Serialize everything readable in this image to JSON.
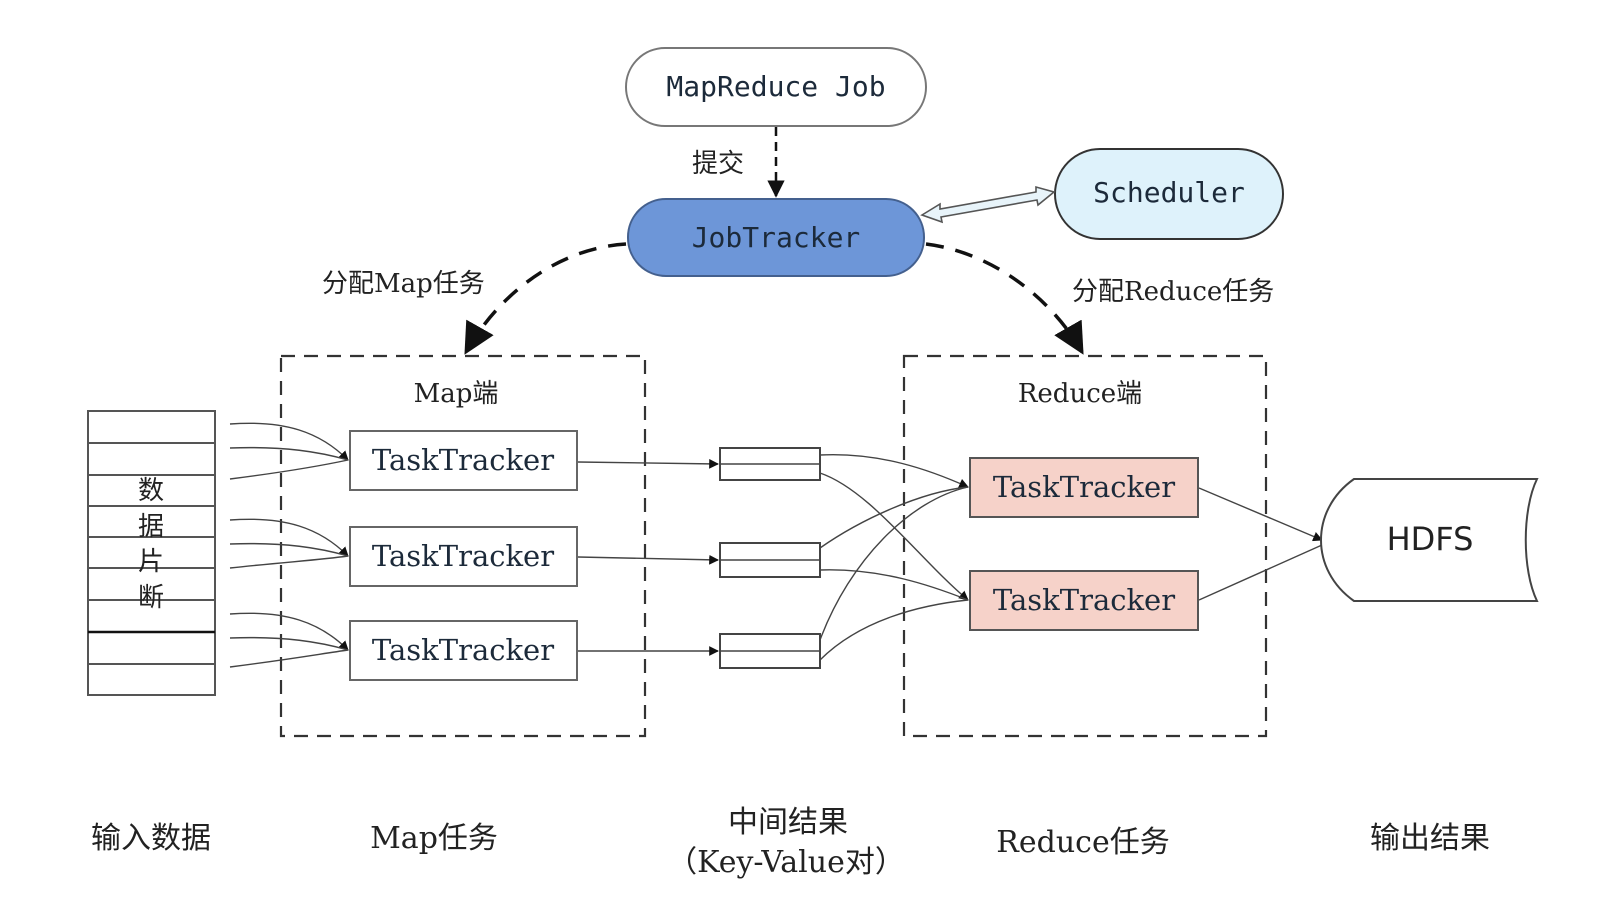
{
  "job": {
    "label": "MapReduce Job"
  },
  "submit": {
    "label": "提交"
  },
  "jobtracker": {
    "label": "JobTracker"
  },
  "scheduler": {
    "label": "Scheduler"
  },
  "assign_map": {
    "label": "分配Map任务"
  },
  "assign_reduce": {
    "label": "分配Reduce任务"
  },
  "map_side": {
    "title": "Map端",
    "trackers": [
      "TaskTracker",
      "TaskTracker",
      "TaskTracker"
    ]
  },
  "reduce_side": {
    "title": "Reduce端",
    "trackers": [
      "TaskTracker",
      "TaskTracker"
    ]
  },
  "input": {
    "chars": [
      "数",
      "据",
      "片",
      "断"
    ]
  },
  "hdfs": {
    "label": "HDFS"
  },
  "captions": {
    "input": "输入数据",
    "map": "Map任务",
    "intermediate_1": "中间结果",
    "intermediate_2": "（Key-Value对）",
    "reduce": "Reduce任务",
    "output": "输出结果"
  },
  "colors": {
    "jobtracker_fill": "#6d96d8",
    "scheduler_fill": "#def2fb",
    "reduce_tracker_fill": "#f6d2c9"
  }
}
